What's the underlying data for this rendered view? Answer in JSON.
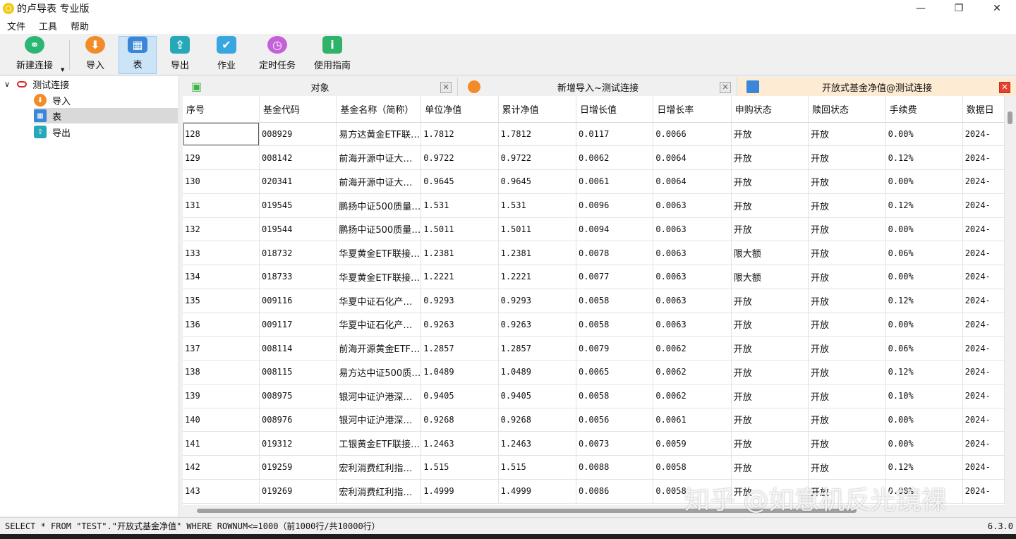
{
  "window": {
    "title": "的卢导表 专业版",
    "minimize": "—",
    "maximize": "❐",
    "close": "✕"
  },
  "menu": [
    "文件",
    "工具",
    "帮助"
  ],
  "toolbar": {
    "new_connection": "新建连接",
    "import": "导入",
    "table": "表",
    "export": "导出",
    "job": "作业",
    "scheduled_task": "定时任务",
    "guide": "使用指南"
  },
  "tree": {
    "root": "测试连接",
    "children": [
      "导入",
      "表",
      "导出"
    ],
    "selected": "表"
  },
  "tabs": [
    {
      "label": "对象",
      "active": false
    },
    {
      "label": "新增导入~测试连接",
      "active": false
    },
    {
      "label": "开放式基金净值@测试连接",
      "active": true
    }
  ],
  "table": {
    "columns": [
      "序号",
      "基金代码",
      "基金名称（简称）",
      "单位净值",
      "累计净值",
      "日增长值",
      "日增长率",
      "申购状态",
      "赎回状态",
      "手续费",
      "数据日"
    ],
    "rows": [
      [
        "128",
        "008929",
        "易方达黄金ETF联…",
        "1.7812",
        "1.7812",
        "0.0117",
        "0.0066",
        "开放",
        "开放",
        "0.00%",
        "2024-"
      ],
      [
        "129",
        "008142",
        "前海开源中证大…",
        "0.9722",
        "0.9722",
        "0.0062",
        "0.0064",
        "开放",
        "开放",
        "0.12%",
        "2024-"
      ],
      [
        "130",
        "020341",
        "前海开源中证大…",
        "0.9645",
        "0.9645",
        "0.0061",
        "0.0064",
        "开放",
        "开放",
        "0.00%",
        "2024-"
      ],
      [
        "131",
        "019545",
        "鹏扬中证500质量…",
        "1.531",
        "1.531",
        "0.0096",
        "0.0063",
        "开放",
        "开放",
        "0.12%",
        "2024-"
      ],
      [
        "132",
        "019544",
        "鹏扬中证500质量…",
        "1.5011",
        "1.5011",
        "0.0094",
        "0.0063",
        "开放",
        "开放",
        "0.00%",
        "2024-"
      ],
      [
        "133",
        "018732",
        "华夏黄金ETF联接…",
        "1.2381",
        "1.2381",
        "0.0078",
        "0.0063",
        "限大额",
        "开放",
        "0.06%",
        "2024-"
      ],
      [
        "134",
        "018733",
        "华夏黄金ETF联接…",
        "1.2221",
        "1.2221",
        "0.0077",
        "0.0063",
        "限大额",
        "开放",
        "0.00%",
        "2024-"
      ],
      [
        "135",
        "009116",
        "华夏中证石化产…",
        "0.9293",
        "0.9293",
        "0.0058",
        "0.0063",
        "开放",
        "开放",
        "0.12%",
        "2024-"
      ],
      [
        "136",
        "009117",
        "华夏中证石化产…",
        "0.9263",
        "0.9263",
        "0.0058",
        "0.0063",
        "开放",
        "开放",
        "0.00%",
        "2024-"
      ],
      [
        "137",
        "008114",
        "前海开源黄金ETF…",
        "1.2857",
        "1.2857",
        "0.0079",
        "0.0062",
        "开放",
        "开放",
        "0.06%",
        "2024-"
      ],
      [
        "138",
        "008115",
        "易方达中证500质…",
        "1.0489",
        "1.0489",
        "0.0065",
        "0.0062",
        "开放",
        "开放",
        "0.12%",
        "2024-"
      ],
      [
        "139",
        "008975",
        "银河中证沪港深…",
        "0.9405",
        "0.9405",
        "0.0058",
        "0.0062",
        "开放",
        "开放",
        "0.10%",
        "2024-"
      ],
      [
        "140",
        "008976",
        "银河中证沪港深…",
        "0.9268",
        "0.9268",
        "0.0056",
        "0.0061",
        "开放",
        "开放",
        "0.00%",
        "2024-"
      ],
      [
        "141",
        "019312",
        "工银黄金ETF联接…",
        "1.2463",
        "1.2463",
        "0.0073",
        "0.0059",
        "开放",
        "开放",
        "0.00%",
        "2024-"
      ],
      [
        "142",
        "019259",
        "宏利消费红利指…",
        "1.515",
        "1.515",
        "0.0088",
        "0.0058",
        "开放",
        "开放",
        "0.12%",
        "2024-"
      ],
      [
        "143",
        "019269",
        "宏利消费红利指…",
        "1.4999",
        "1.4999",
        "0.0086",
        "0.0058",
        "开放",
        "开放",
        "0.00%",
        "2024-"
      ]
    ]
  },
  "status": {
    "sql": "SELECT * FROM \"TEST\".\"开放式基金净值\" WHERE ROWNUM<=1000（前1000行/共10000行）",
    "version": "6.3.0"
  },
  "watermark": "知乎 @如意机反光镜裸",
  "colors": {
    "accent": "#cce4f7",
    "active_tab": "#fdebd3",
    "close_red": "#e8412e"
  }
}
